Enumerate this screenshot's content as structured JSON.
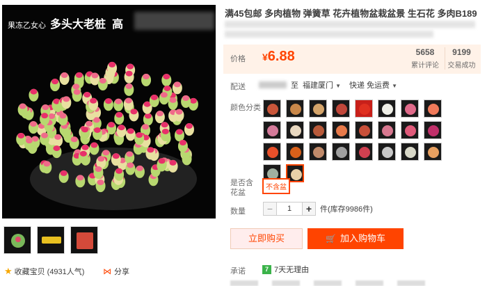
{
  "image": {
    "title_small": "果冻乙女心",
    "title_big": "多头大老桩",
    "title_fragment": "高"
  },
  "thumbnails": [
    "thumb-1",
    "thumb-2",
    "thumb-3"
  ],
  "favorites": {
    "label": "收藏宝贝",
    "count": "(4931人气)"
  },
  "share_label": "分享",
  "product": {
    "title": "满45包邮 多肉植物 弹簧草 花卉植物盆栽盆景 生石花 多肉B189"
  },
  "price": {
    "label": "价格",
    "currency": "¥",
    "value": "6.88",
    "reviews_count": "5658",
    "reviews_label": "累计评论",
    "sold_count": "9199",
    "sold_label": "交易成功"
  },
  "shipping": {
    "label": "配送",
    "to": "至",
    "destination": "福建厦门",
    "method": "快递 免运费"
  },
  "color": {
    "label": "颜色分类",
    "swatches": [
      "#c9563a",
      "#c9884a",
      "#d4a46a",
      "#c1473a",
      "#e03020",
      "#f0f0e8",
      "#e06a8a",
      "#f07a5a",
      "#d47a9a",
      "#e8d8c0",
      "#b85a3a",
      "#e87a4a",
      "#c8503a",
      "#d87890",
      "#e05a7a",
      "#c0306a",
      "#e8502a",
      "#d8601a",
      "#c08a6a",
      "#a0a0a0",
      "#d04050",
      "#c8c8c8",
      "#d8d8c8",
      "#e8a060",
      "#a0b0a0",
      "#e8d0a8"
    ],
    "selected_index": 25
  },
  "pot": {
    "label": "是否含花盆",
    "option": "不含盆"
  },
  "quantity": {
    "label": "数量",
    "value": "1",
    "minus": "−",
    "plus": "+",
    "stock": "件(库存9986件)"
  },
  "actions": {
    "buy_now": "立即购买",
    "add_cart": "加入购物车"
  },
  "promise": {
    "label": "承诺",
    "badge": "7",
    "text": "7天无理由"
  }
}
